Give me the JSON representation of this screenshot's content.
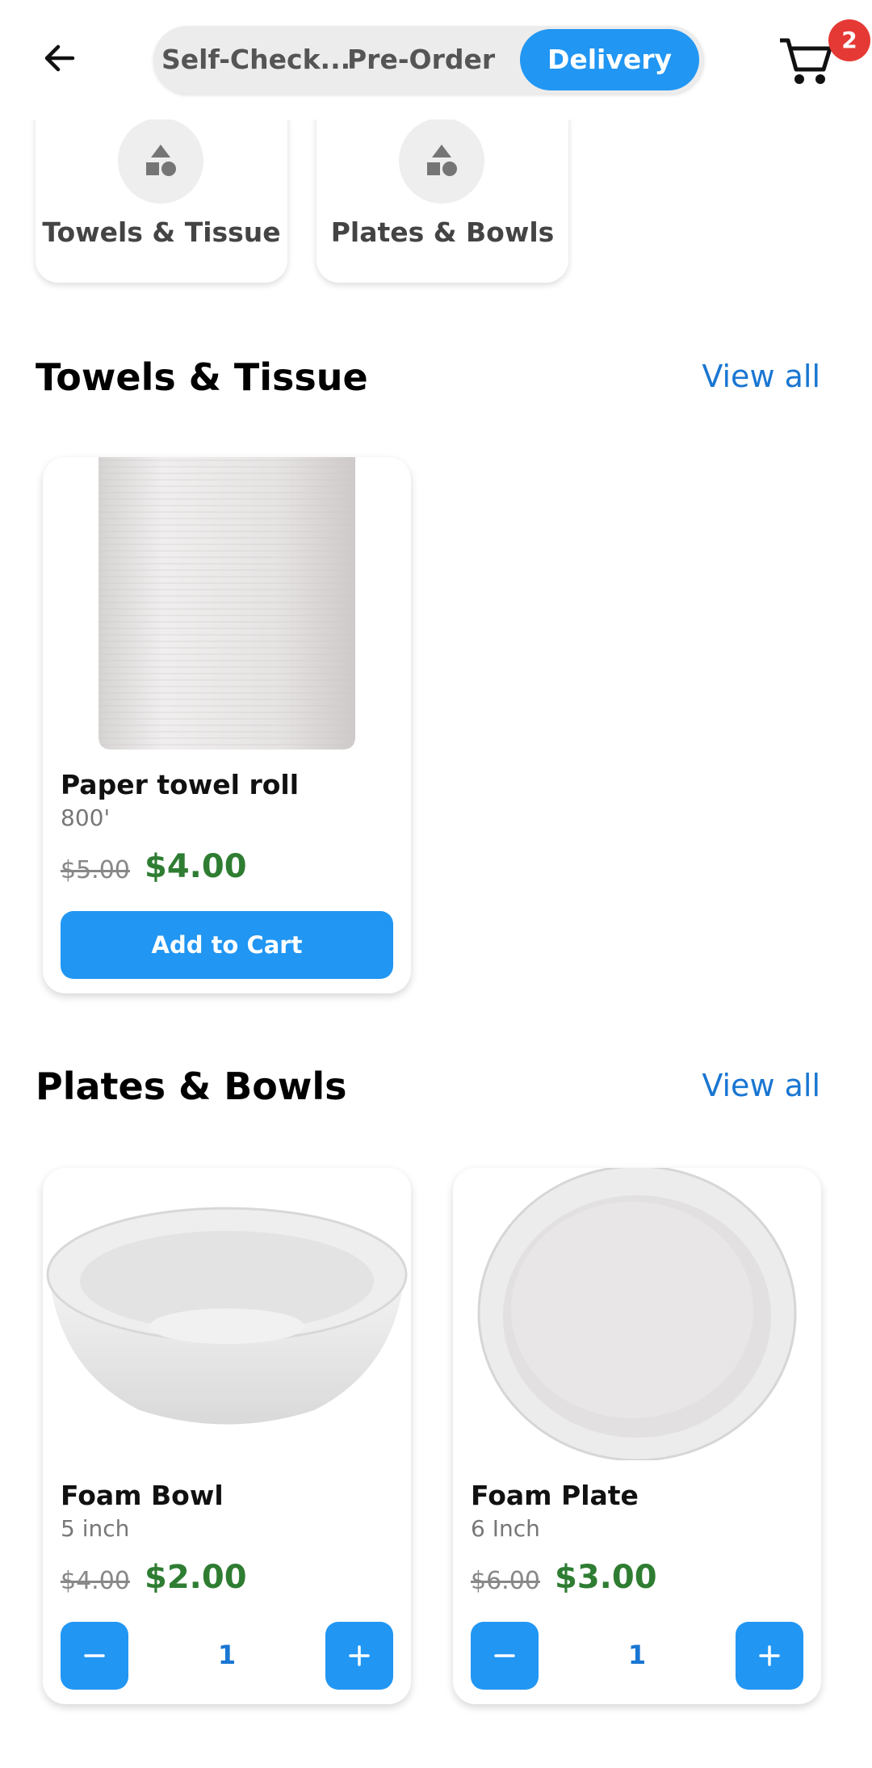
{
  "header": {
    "tabs": [
      "Self-Check...",
      "Pre-Order",
      "Delivery"
    ],
    "active_tab": "Delivery",
    "cart_count": "2"
  },
  "categories": [
    {
      "label": "Towels & Tissue",
      "icon": "shapes-icon"
    },
    {
      "label": "Plates & Bowls",
      "icon": "shapes-icon"
    }
  ],
  "sections": [
    {
      "title": "Towels & Tissue",
      "view_all": "View all",
      "products": [
        {
          "name": "Paper towel roll",
          "sub": "800'",
          "old_price": "$5.00",
          "price": "$4.00",
          "action": "Add to Cart"
        }
      ]
    },
    {
      "title": "Plates & Bowls",
      "view_all": "View all",
      "products": [
        {
          "name": "Foam Bowl",
          "sub": "5 inch",
          "old_price": "$4.00",
          "price": "$2.00",
          "qty": "1"
        },
        {
          "name": "Foam Plate",
          "sub": "6 Inch",
          "old_price": "$6.00",
          "price": "$3.00",
          "qty": "1"
        }
      ]
    }
  ],
  "colors": {
    "accent": "#2196f3",
    "price_green": "#2e7d32",
    "badge_red": "#e53935",
    "link_blue": "#1976d2"
  }
}
